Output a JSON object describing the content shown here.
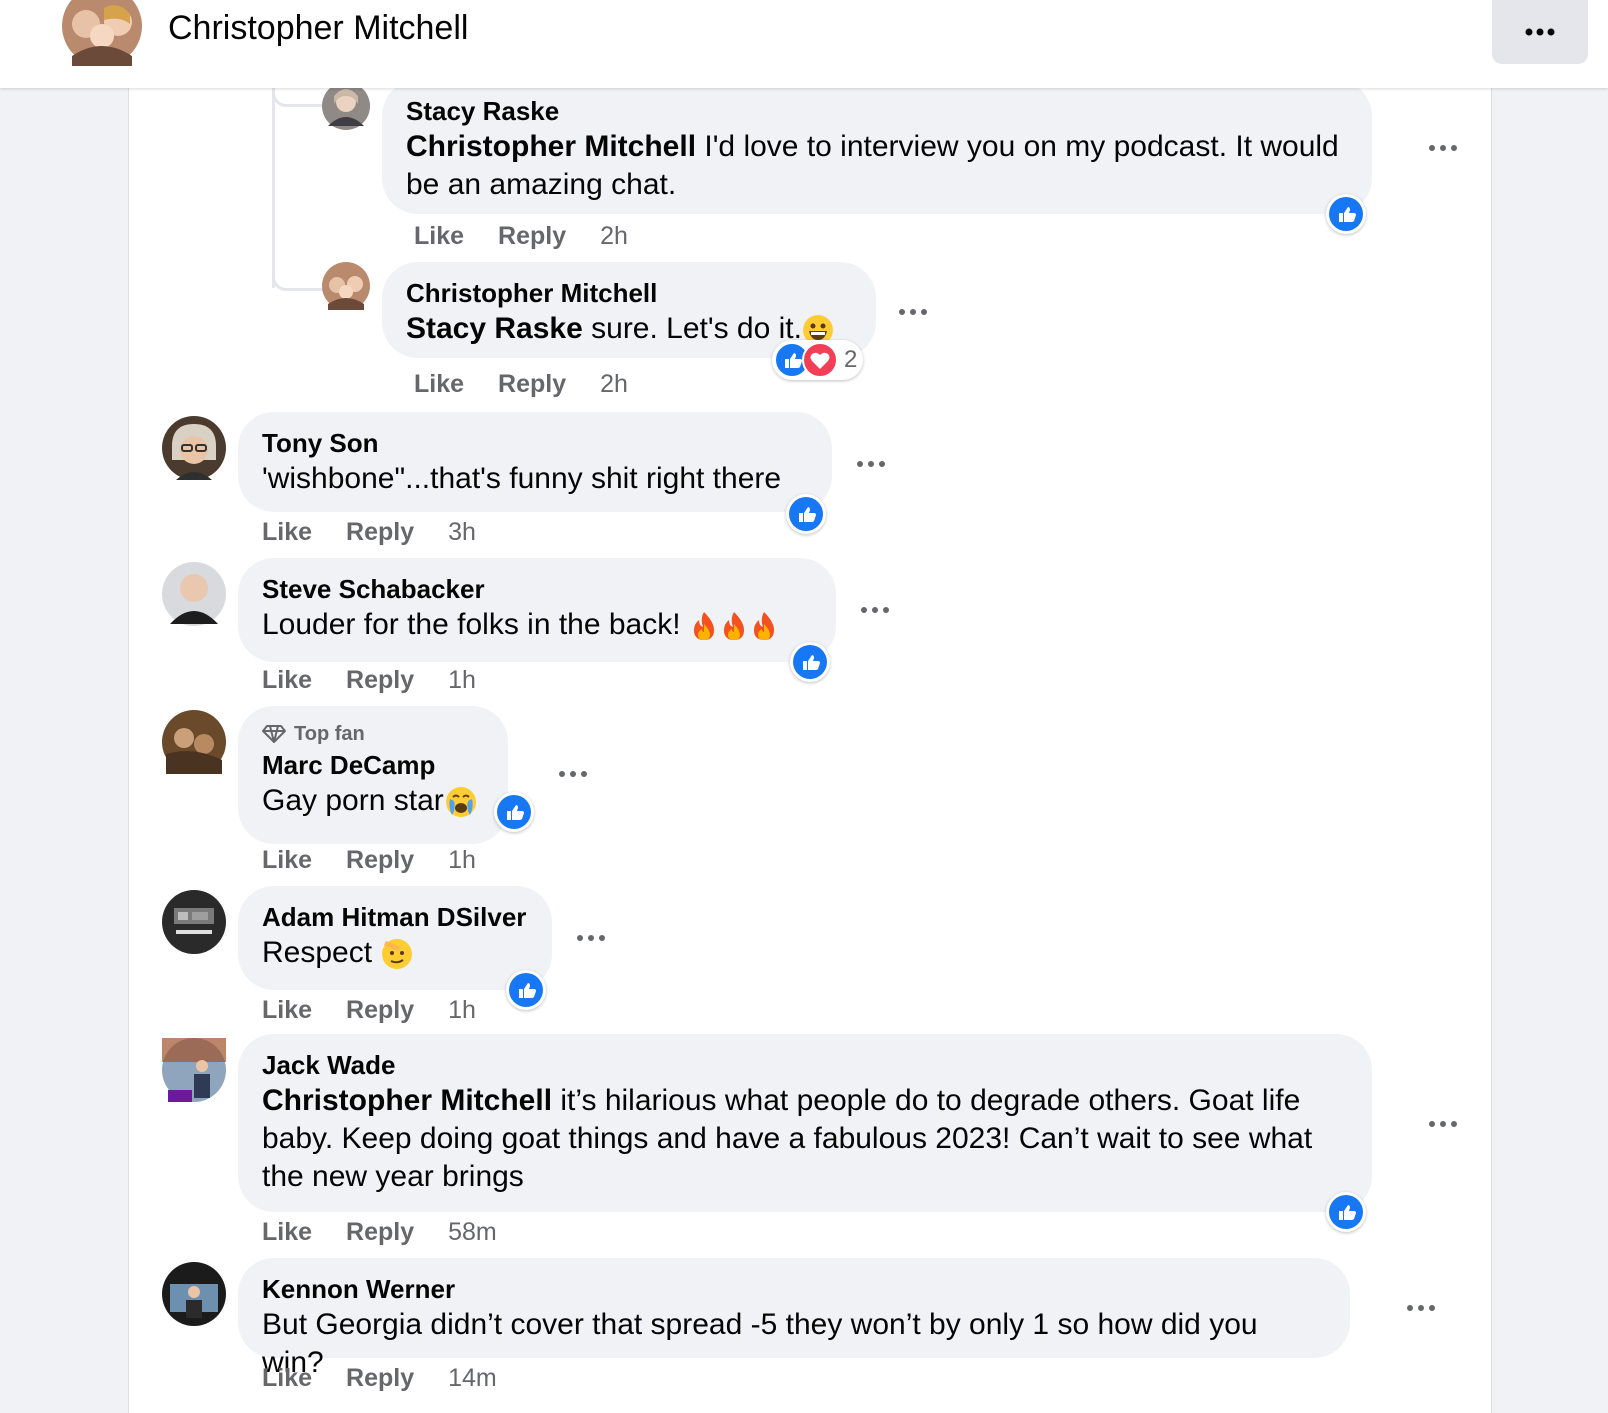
{
  "header": {
    "title": "Christopher Mitchell"
  },
  "actions": {
    "like": "Like",
    "reply": "Reply"
  },
  "comments": [
    {
      "author": "Stacy Raske",
      "mention": "Christopher Mitchell",
      "text": " I'd love to interview you on my podcast. It would be an amazing chat.",
      "time": "2h"
    },
    {
      "author": "Christopher Mitchell",
      "mention": "Stacy Raske",
      "text": " sure. Let's do it.",
      "time": "2h",
      "reaction_count": "2"
    },
    {
      "author": "Tony Son",
      "text": "'wishbone\"...that's funny shit right there",
      "time": "3h"
    },
    {
      "author": "Steve Schabacker",
      "text": "Louder for the folks in the back!",
      "time": "1h"
    },
    {
      "badge": "Top fan",
      "author": "Marc DeCamp",
      "text": "Gay porn star",
      "time": "1h"
    },
    {
      "author": "Adam Hitman DSilver",
      "text": "Respect",
      "time": "1h"
    },
    {
      "author": "Jack Wade",
      "mention": "Christopher Mitchell",
      "text": " it’s hilarious what people do to degrade others. Goat life baby. Keep doing goat things and have a fabulous 2023! Can’t wait to see what the new year brings",
      "time": "58m"
    },
    {
      "author": "Kennon Werner",
      "text": "But Georgia didn’t cover that spread -5 they won’t by only 1 so how did you win?",
      "time": "14m"
    }
  ],
  "colors": {
    "like_blue": "#1877f2",
    "love_red": "#f33e58",
    "bubble_bg": "#f0f2f5",
    "meta_gray": "#65676b"
  }
}
